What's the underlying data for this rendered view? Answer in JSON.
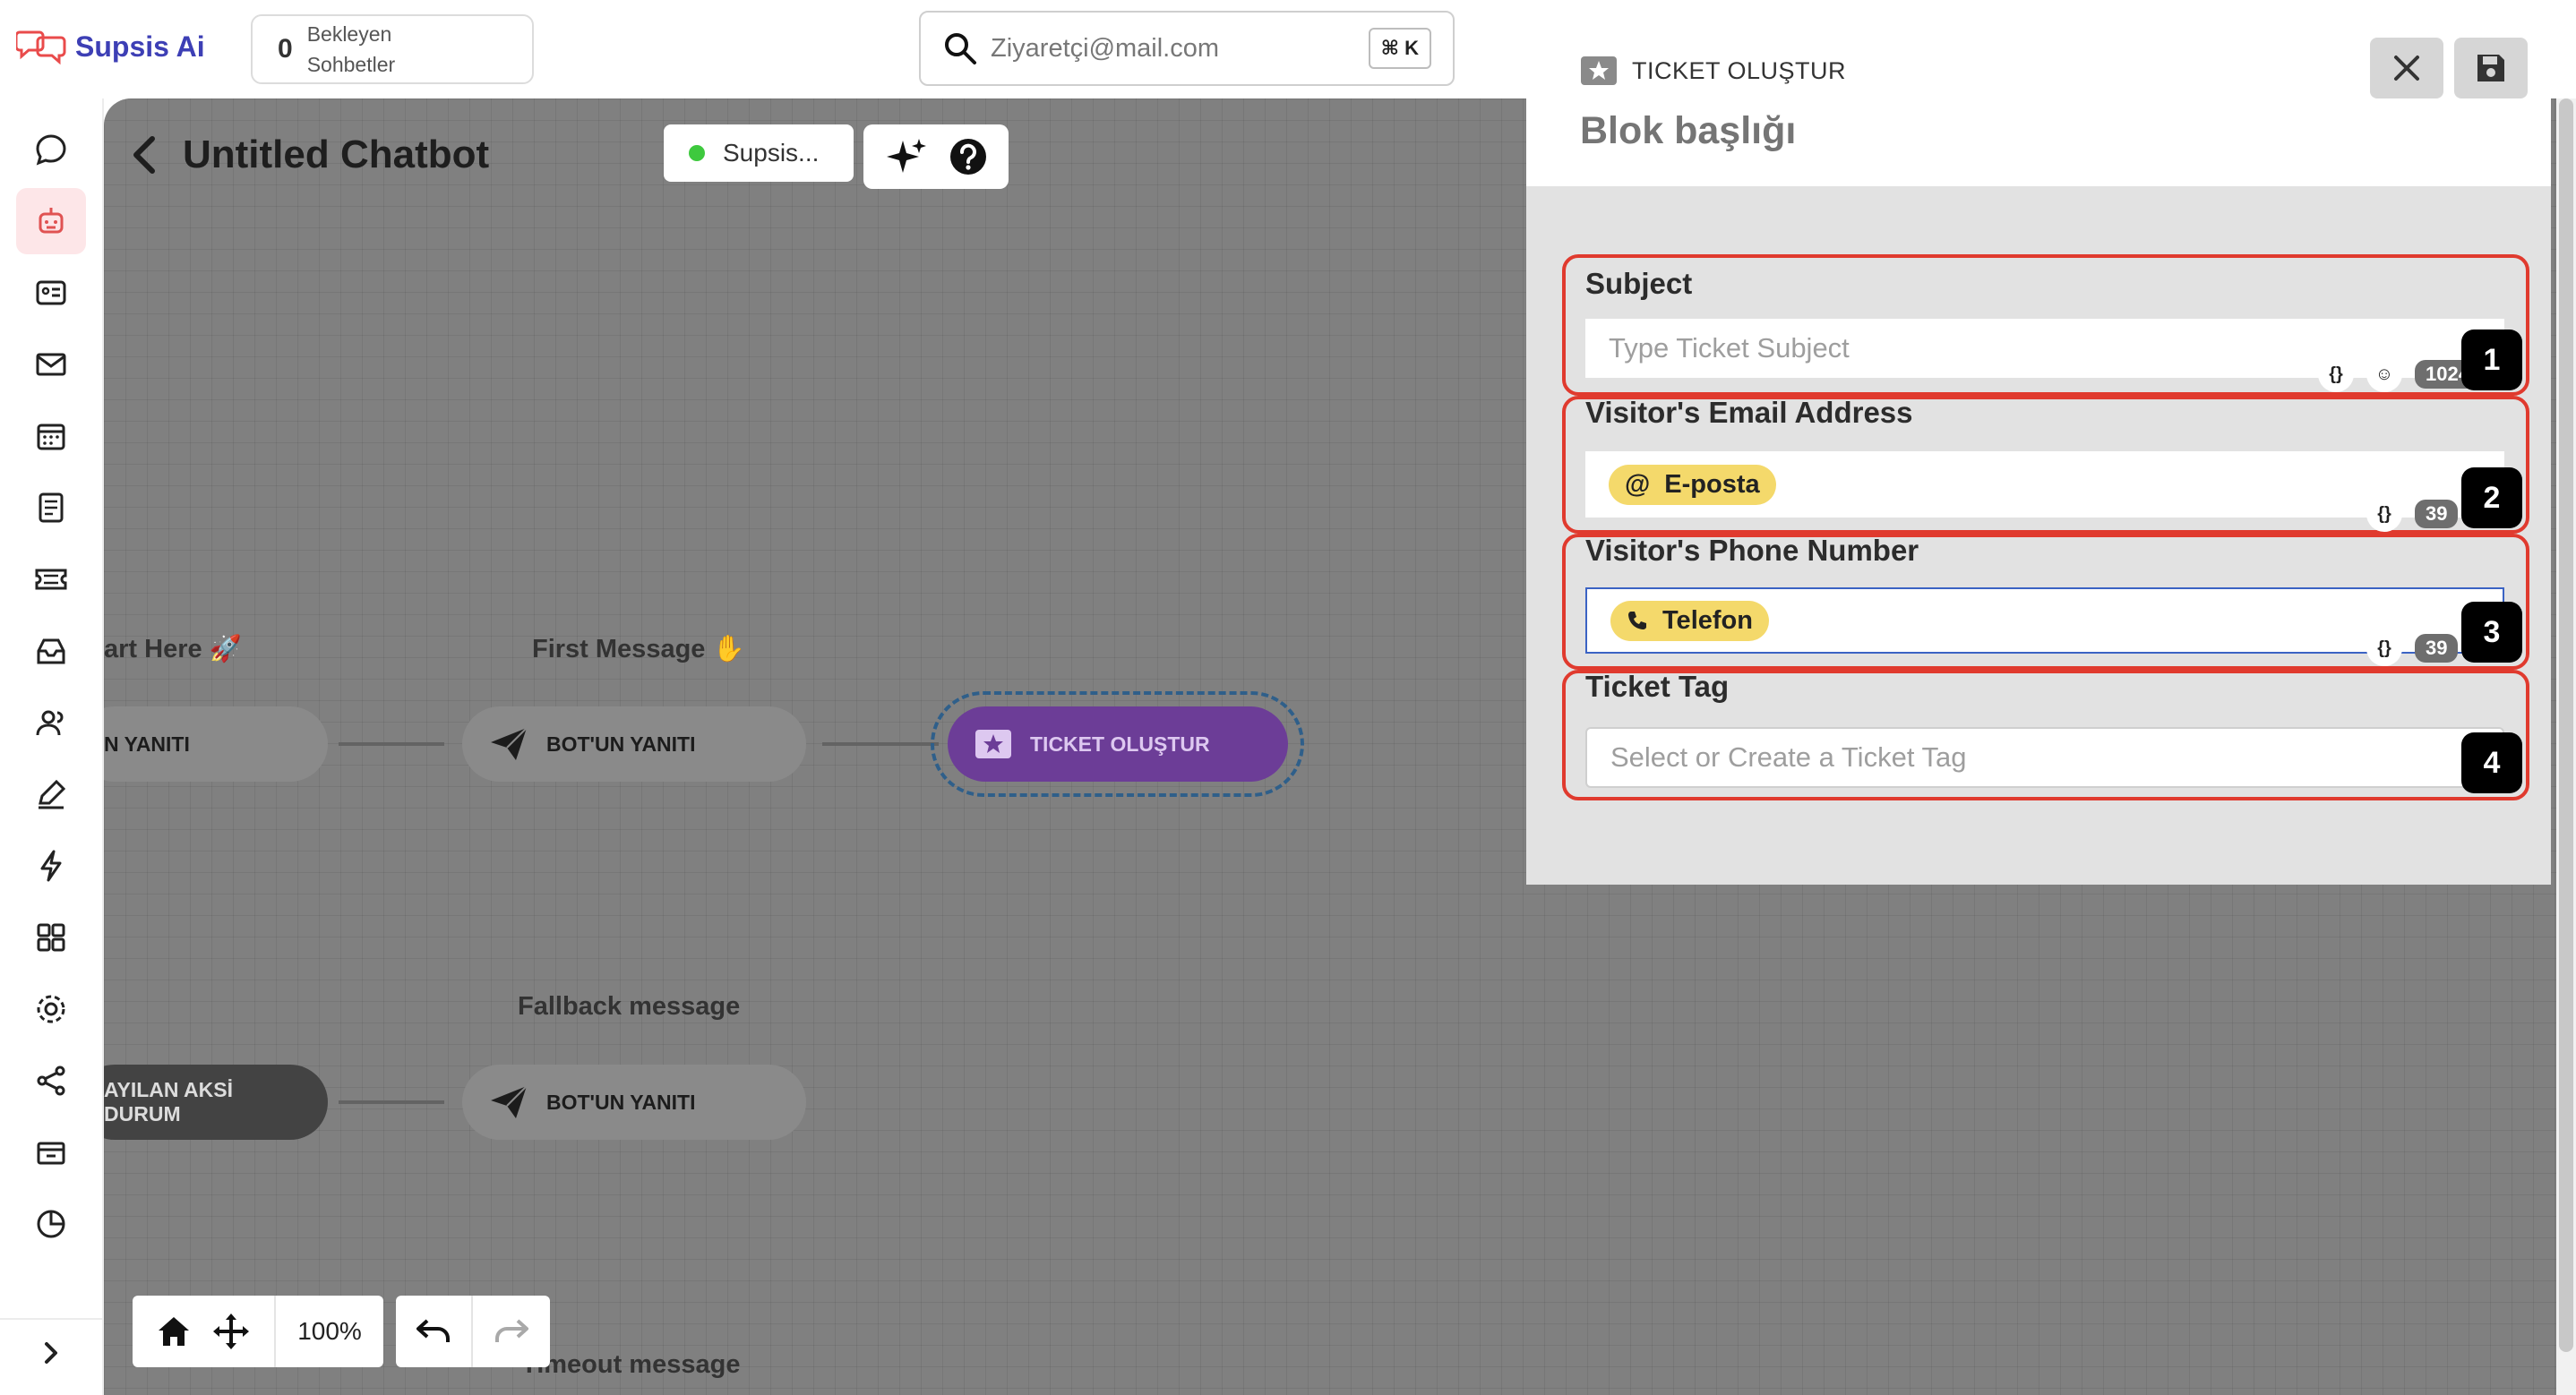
{
  "brand": {
    "name": "Supsis Ai"
  },
  "pending": {
    "count": "0",
    "label": "Bekleyen\nSohbetler"
  },
  "search": {
    "value": "Ziyaretçi@mail.com",
    "shortcut": "⌘ K"
  },
  "sidebar": {
    "items": [
      {
        "name": "chat-bubble-icon"
      },
      {
        "name": "bot-icon",
        "active": true
      },
      {
        "name": "contact-card-icon"
      },
      {
        "name": "mail-icon"
      },
      {
        "name": "calendar-icon"
      },
      {
        "name": "notes-icon"
      },
      {
        "name": "ticket-icon"
      },
      {
        "name": "inbox-icon"
      },
      {
        "name": "users-icon"
      },
      {
        "name": "edit-icon"
      },
      {
        "name": "lightning-icon"
      },
      {
        "name": "grid-icon"
      },
      {
        "name": "settings-icon"
      },
      {
        "name": "share-icon"
      },
      {
        "name": "archive-icon"
      },
      {
        "name": "chart-icon"
      }
    ]
  },
  "canvas": {
    "title": "Untitled Chatbot",
    "status": "Supsis...",
    "labels": {
      "start": "art Here 🚀",
      "first_message": "First Message ✋",
      "fallback": "Fallback message",
      "timeout": "Timeout message"
    },
    "nodes": {
      "start_reply": "N YANITI",
      "bot_reply_1": "BOT'UN YANITI",
      "ticket": "TICKET OLUŞTUR",
      "default_case": "AYILAN AKSİ DURUM",
      "bot_reply_2": "BOT'UN YANITI"
    },
    "zoom": "100%"
  },
  "panel": {
    "type": "TICKET OLUŞTUR",
    "title": "Blok başlığı",
    "fields": [
      {
        "label": "Subject",
        "placeholder": "Type Ticket Subject",
        "counter": "1024",
        "badge": "1"
      },
      {
        "label": "Visitor's Email Address",
        "chip": "E-posta",
        "counter": "39",
        "badge": "2"
      },
      {
        "label": "Visitor's Phone Number",
        "chip": "Telefon",
        "counter": "39",
        "badge": "3"
      },
      {
        "label": "Ticket Tag",
        "placeholder": "Select or Create a Ticket Tag",
        "badge": "4"
      }
    ]
  },
  "colors": {
    "brand": "#3d3fb5",
    "highlight": "#e03a2e",
    "ticket_node": "#6c3d97",
    "chip": "#f4d96b"
  }
}
